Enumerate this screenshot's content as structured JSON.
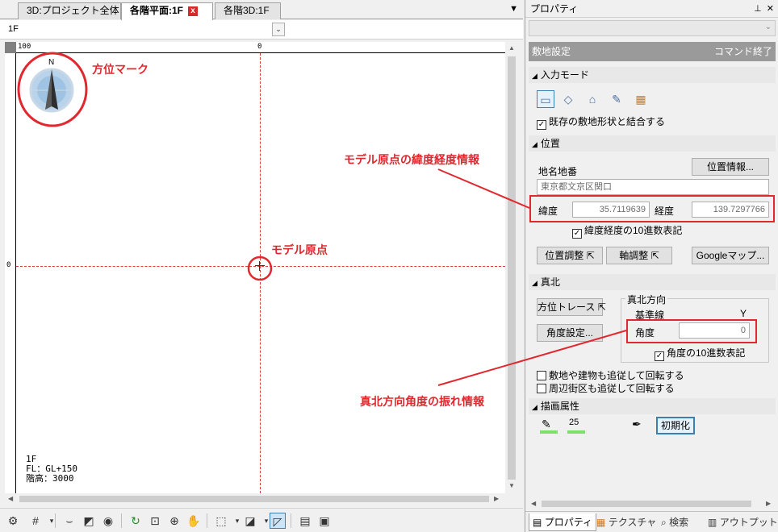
{
  "tabs": [
    {
      "label": "3D:プロジェクト全体"
    },
    {
      "label": "各階平面:1F",
      "close": "x"
    },
    {
      "label": "各階3D:1F"
    }
  ],
  "tab_menu": "▼",
  "floor_select": {
    "value": "1F",
    "dropdown": "⌄"
  },
  "ruler": {
    "top_left": "100",
    "top_center": "0",
    "left_center": "0"
  },
  "compass": {
    "label": "N"
  },
  "floor_info": {
    "line1": "1F",
    "line2": "FL：GL+150",
    "line3": "階高：3000"
  },
  "annotations": {
    "compass_mark": "方位マーク",
    "origin_latlon": "モデル原点の緯度経度情報",
    "origin": "モデル原点",
    "north_angle": "真北方向角度の振れ情報"
  },
  "props": {
    "title": "プロパティ",
    "pin": "ᵖ",
    "close": "✕",
    "header": "敷地設定",
    "header_end": "コマンド終了",
    "input_mode": {
      "title": "入力モード",
      "merge_label": "既存の敷地形状と結合する",
      "merge_checked": "✓"
    },
    "position": {
      "title": "位置",
      "address_label": "地名地番",
      "info_button": "位置情報...",
      "address_value": "東京都文京区関口",
      "lat_label": "緯度",
      "lat_value": "35.7119639",
      "lon_label": "経度",
      "lon_value": "139.7297766",
      "decimal_label": "緯度経度の10進数表記",
      "decimal_checked": "✓",
      "adjust_button": "位置調整",
      "axis_button": "軸調整",
      "google_button": "Googleマップ..."
    },
    "true_north": {
      "title": "真北",
      "trace_button": "方位トレース",
      "angle_button": "角度設定...",
      "group_title": "真北方向",
      "base_label": "基準線",
      "base_value": "Y",
      "angle_label": "角度",
      "angle_value": "0",
      "angle_decimal_label": "角度の10進数表記",
      "angle_decimal_checked": "✓",
      "rotate_label": "敷地や建物も追従して回転する",
      "rotate_streets_label": "周辺街区も追従して回転する"
    },
    "drawing": {
      "title": "描画属性",
      "width_value": "25",
      "reset_button": "初期化"
    },
    "bottom_tabs": [
      {
        "label": "プロパティ"
      },
      {
        "label": "テクスチャ"
      },
      {
        "label": "検索"
      },
      {
        "label": "アウトプット"
      }
    ]
  },
  "colors": {
    "annotation": "#e0282f",
    "accent": "#3c7fb1",
    "header_bg": "#9a9a9a"
  }
}
